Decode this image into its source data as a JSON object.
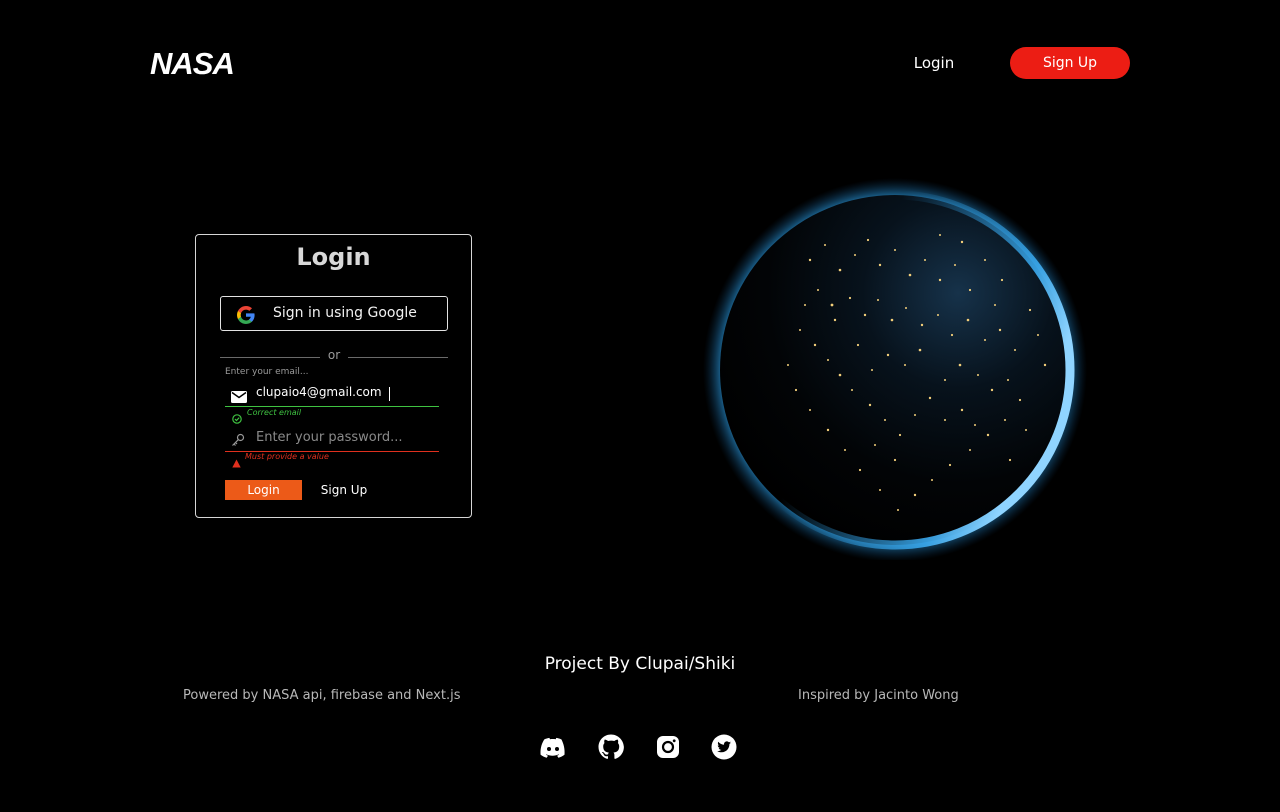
{
  "header": {
    "logo_text": "NASA",
    "login_label": "Login",
    "signup_label": "Sign Up",
    "accent_color": "#ec1d14"
  },
  "login_card": {
    "title": "Login",
    "google_button_label": "Sign in using Google",
    "divider_text": "or",
    "email": {
      "caption": "Enter your email...",
      "value": "clupaio4@gmail.com",
      "status_text": "Correct email",
      "status_color": "#3fc241",
      "icon": "mail-icon"
    },
    "password": {
      "placeholder": "Enter your password...",
      "error_text": "Must provide a value",
      "error_color": "#e0301e",
      "icon": "key-icon"
    },
    "login_button_label": "Login",
    "signup_button_label": "Sign Up",
    "login_button_color": "#ec5a18"
  },
  "footer": {
    "title": "Project By Clupai/Shiki",
    "powered_by": "Powered by NASA api, firebase and Next.js",
    "inspired_by": "Inspired by Jacinto Wong",
    "social_icons": [
      "discord-icon",
      "github-icon",
      "instagram-icon",
      "twitter-icon"
    ]
  }
}
